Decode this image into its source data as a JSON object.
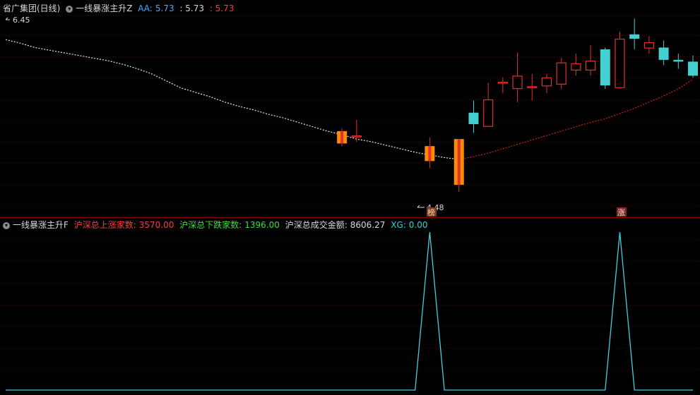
{
  "top_header": {
    "stock_name": "省广集团(日线)",
    "indicator_name": "一线暴涨主升Z",
    "aa_label": "AA:",
    "aa_value": "5.73",
    "value2": ": 5.73",
    "value3": ": 5.73"
  },
  "bottom_header": {
    "indicator_name": "一线暴涨主升F",
    "up_label": "沪深总上涨家数:",
    "up_value": "3570.00",
    "down_label": "沪深总下跌家数:",
    "down_value": "1396.00",
    "amount_label": "沪深总成交金额:",
    "amount_value": "8606.27",
    "xg_label": "XG:",
    "xg_value": "0.00"
  },
  "colors": {
    "background": "#000000",
    "grid": "#5a0000",
    "up_candle": "#e03030",
    "down_candle": "#44d0d0",
    "highlight_candle": "#ff8c00",
    "ma_before": "#e8e8e8",
    "ma_after": "#d02020",
    "xg_line": "#40d0e0"
  },
  "chart_data": [
    {
      "type": "candlestick",
      "title": "省广集团(日线)",
      "ylim": [
        4.4,
        6.5
      ],
      "annotations": [
        {
          "text": "6.45",
          "kind": "high"
        },
        {
          "text": "4.48",
          "kind": "low"
        },
        {
          "text": "榜",
          "kind": "marker"
        },
        {
          "text": "涨",
          "kind": "marker"
        }
      ],
      "candles": [
        {
          "i": 23,
          "o": 5.17,
          "h": 5.2,
          "l": 5.0,
          "c": 5.03,
          "hl": true
        },
        {
          "i": 24,
          "o": 5.1,
          "h": 5.3,
          "l": 5.05,
          "c": 5.12
        },
        {
          "i": 29,
          "o": 5.0,
          "h": 5.1,
          "l": 4.75,
          "c": 4.83,
          "hl": true
        },
        {
          "i": 31,
          "o": 5.08,
          "h": 5.08,
          "l": 4.48,
          "c": 4.56,
          "hl": true
        },
        {
          "i": 32,
          "o": 5.38,
          "h": 5.52,
          "l": 5.15,
          "c": 5.25
        },
        {
          "i": 33,
          "o": 5.22,
          "h": 5.72,
          "l": 5.22,
          "c": 5.53
        },
        {
          "i": 34,
          "o": 5.71,
          "h": 5.78,
          "l": 5.6,
          "c": 5.73
        },
        {
          "i": 35,
          "o": 5.65,
          "h": 6.06,
          "l": 5.5,
          "c": 5.8
        },
        {
          "i": 36,
          "o": 5.66,
          "h": 5.82,
          "l": 5.52,
          "c": 5.68
        },
        {
          "i": 37,
          "o": 5.68,
          "h": 5.82,
          "l": 5.6,
          "c": 5.78
        },
        {
          "i": 38,
          "o": 5.7,
          "h": 6.0,
          "l": 5.65,
          "c": 5.95
        },
        {
          "i": 39,
          "o": 5.86,
          "h": 6.05,
          "l": 5.8,
          "c": 5.94
        },
        {
          "i": 40,
          "o": 5.86,
          "h": 6.15,
          "l": 5.8,
          "c": 5.97
        },
        {
          "i": 41,
          "o": 6.1,
          "h": 6.12,
          "l": 5.65,
          "c": 5.69
        },
        {
          "i": 42,
          "o": 5.66,
          "h": 6.3,
          "l": 5.66,
          "c": 6.22
        },
        {
          "i": 43,
          "o": 6.27,
          "h": 6.45,
          "l": 6.1,
          "c": 6.22
        },
        {
          "i": 44,
          "o": 6.11,
          "h": 6.25,
          "l": 6.05,
          "c": 6.18
        },
        {
          "i": 45,
          "o": 6.12,
          "h": 6.2,
          "l": 5.92,
          "c": 5.98
        },
        {
          "i": 46,
          "o": 5.98,
          "h": 6.05,
          "l": 5.88,
          "c": 5.96
        },
        {
          "i": 47,
          "o": 5.96,
          "h": 6.03,
          "l": 5.78,
          "c": 5.8
        }
      ],
      "ma": [
        6.21,
        6.17,
        6.12,
        6.09,
        6.06,
        6.03,
        6.0,
        5.97,
        5.93,
        5.88,
        5.82,
        5.74,
        5.66,
        5.61,
        5.56,
        5.5,
        5.45,
        5.41,
        5.36,
        5.32,
        5.27,
        5.22,
        5.17,
        5.13,
        5.08,
        5.05,
        5.01,
        4.97,
        4.93,
        4.9,
        4.87,
        4.85,
        4.88,
        4.92,
        4.97,
        5.02,
        5.07,
        5.12,
        5.17,
        5.22,
        5.27,
        5.31,
        5.37,
        5.43,
        5.5,
        5.57,
        5.65,
        5.76
      ]
    },
    {
      "type": "line",
      "title": "一线暴涨主升F",
      "series": [
        {
          "name": "XG",
          "values": [
            0,
            0,
            0,
            0,
            0,
            0,
            0,
            0,
            0,
            0,
            0,
            0,
            0,
            0,
            0,
            0,
            0,
            0,
            0,
            0,
            0,
            0,
            0,
            0,
            0,
            0,
            0,
            0,
            0,
            1,
            0,
            0,
            0,
            0,
            0,
            0,
            0,
            0,
            0,
            0,
            0,
            0,
            1,
            0,
            0,
            0,
            0,
            0
          ]
        }
      ],
      "ylim": [
        0,
        1
      ]
    }
  ]
}
